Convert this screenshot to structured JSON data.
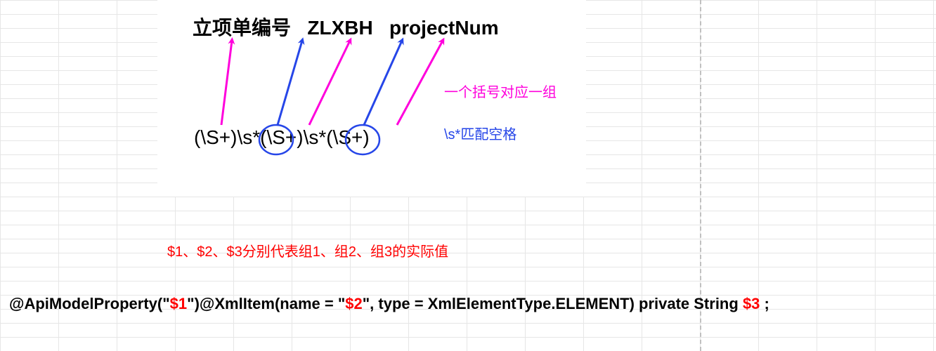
{
  "header": {
    "label1": "立项单编号",
    "label2": "ZLXBH",
    "label3": "projectNum"
  },
  "regex": {
    "full": "(\\S+)\\s*(\\S+)\\s*(\\S+)"
  },
  "notes": {
    "magenta": "一个括号对应一组",
    "blue": "\\s*匹配空格"
  },
  "desc": "$1、$2、$3分别代表组1、组2、组3的实际值",
  "code": {
    "p1": "@ApiModelProperty(\"",
    "v1": "$1",
    "p2": "\")@XmlItem(name = \"",
    "v2": "$2",
    "p3": "\", type = XmlElementType.ELEMENT) private String ",
    "v3": "$3",
    "p4": " ;"
  },
  "colors": {
    "magenta": "#ff00dc",
    "blue": "#2646e8",
    "red": "#ff0000"
  }
}
